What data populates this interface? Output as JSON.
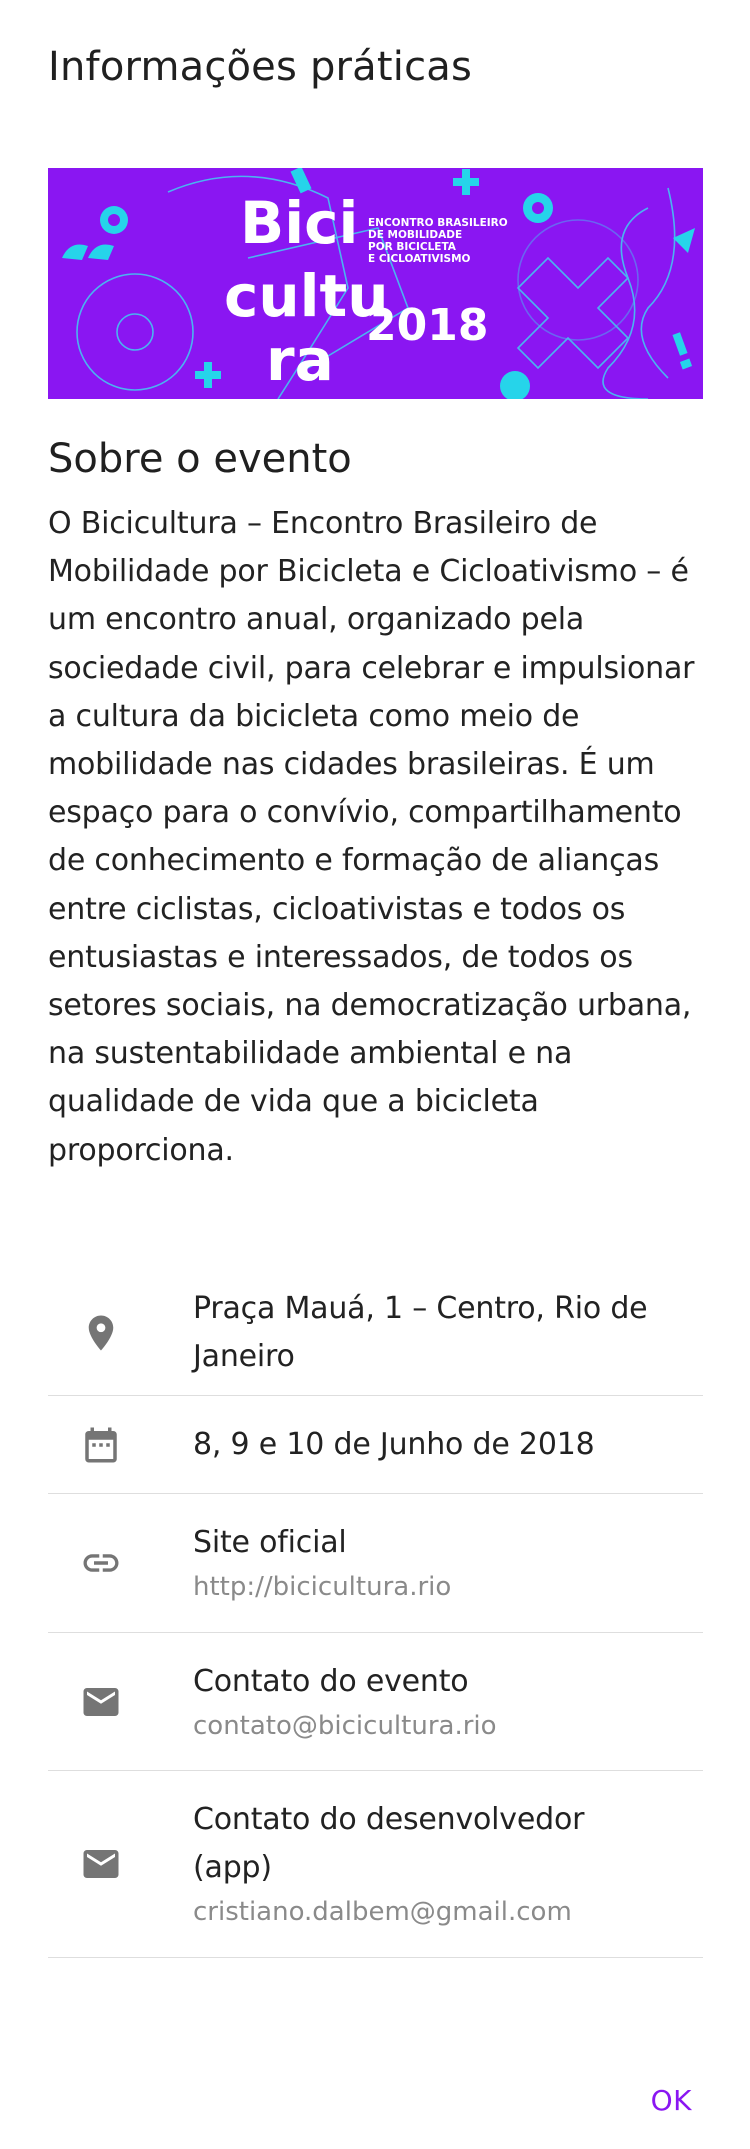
{
  "dialog": {
    "title": "Informações práticas"
  },
  "banner": {
    "background_color": "#8a16f2",
    "accent_color": "#26d4ea",
    "logo_lines": [
      "Bici",
      "cultu",
      "ra"
    ],
    "year": "2018",
    "tagline": [
      "ENCONTRO BRASILEIRO",
      "DE MOBILIDADE",
      "POR BICICLETA",
      "E CICLOATIVISMO"
    ]
  },
  "about": {
    "title": "Sobre o evento",
    "text": "O Bicicultura – Encontro Brasileiro de Mobilidade por Bicicleta e Cicloativismo – é um encontro anual, organizado pela sociedade civil, para celebrar e impulsionar a cultura da bicicleta como meio de mobilidade nas cidades brasileiras. É um espaço para o convívio, compartilhamento de conhecimento e formação de alianças entre ciclistas, cicloativistas e todos os entusiastas e interessados, de todos os setores sociais, na democratização urbana, na sustentabilidade ambiental e na qualidade de vida que a bicicleta proporciona."
  },
  "info": {
    "location": {
      "icon": "location-pin-icon",
      "text": "Praça Mauá, 1 – Centro, Rio de Janeiro"
    },
    "date": {
      "icon": "calendar-icon",
      "text": "8, 9 e 10 de Junho de 2018"
    },
    "site": {
      "icon": "link-icon",
      "label": "Site oficial",
      "value": "http://bicicultura.rio"
    },
    "event_contact": {
      "icon": "email-icon",
      "label": "Contato do evento",
      "value": "contato@bicicultura.rio"
    },
    "dev_contact": {
      "icon": "email-icon",
      "label": "Contato do desenvolvedor (app)",
      "value": "cristiano.dalbem@gmail.com"
    }
  },
  "actions": {
    "ok_label": "OK",
    "accent_color": "#8a16f2"
  }
}
